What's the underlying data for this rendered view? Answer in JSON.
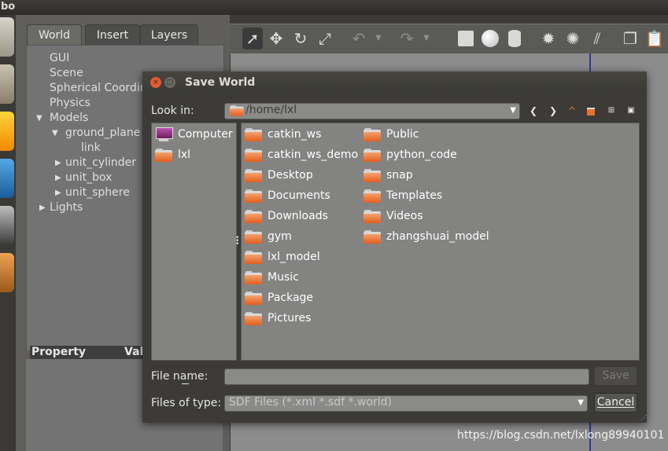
{
  "app": {
    "title_fragment": "bo"
  },
  "left_panel": {
    "tabs": [
      {
        "label": "World"
      },
      {
        "label": "Insert"
      },
      {
        "label": "Layers"
      }
    ],
    "tree": {
      "gui": "GUI",
      "scene": "Scene",
      "spherical": "Spherical Coordin",
      "physics": "Physics",
      "models": "Models",
      "ground_plane": "ground_plane",
      "link": "link",
      "unit_cylinder": "unit_cylinder",
      "unit_box": "unit_box",
      "unit_sphere": "unit_sphere",
      "lights": "Lights"
    },
    "property_header": {
      "property": "Property",
      "value": "Val"
    }
  },
  "toolbar": {
    "icons": [
      "select-arrow-icon",
      "translate-icon",
      "rotate-icon",
      "scale-icon",
      "undo-icon",
      "undo-dropdown-icon",
      "redo-icon",
      "redo-dropdown-icon",
      "box-shape-icon",
      "sphere-shape-icon",
      "cylinder-shape-icon",
      "point-light-icon",
      "spot-light-icon",
      "directional-light-icon",
      "copy-icon",
      "paste-icon"
    ]
  },
  "dialog": {
    "title": "Save World",
    "look_in_label": "Look in:",
    "look_in_path": "/home/lxl",
    "sidebar": [
      {
        "label": "Computer",
        "icon": "computer-icon"
      },
      {
        "label": "lxl",
        "icon": "folder-icon"
      }
    ],
    "folders_col1": [
      "catkin_ws",
      "catkin_ws_demo",
      "Desktop",
      "Documents",
      "Downloads",
      "gym",
      "lxl_model",
      "Music",
      "Package",
      "Pictures"
    ],
    "folders_col2": [
      "Public",
      "python_code",
      "snap",
      "Templates",
      "Videos",
      "zhangshuai_model"
    ],
    "file_name_label": "File name:",
    "file_name_value": "",
    "files_of_type_label": "Files of type:",
    "files_of_type_value": "SDF Files (*.xml *.sdf *.world)",
    "save_label": "Save",
    "cancel_label": "Cancel"
  },
  "watermark": "https://blog.csdn.net/lxlong89940101",
  "colors": {
    "folder_orange": "#e86a2c",
    "dialog_bg": "#3c3b37",
    "panel_bg": "#838382"
  }
}
